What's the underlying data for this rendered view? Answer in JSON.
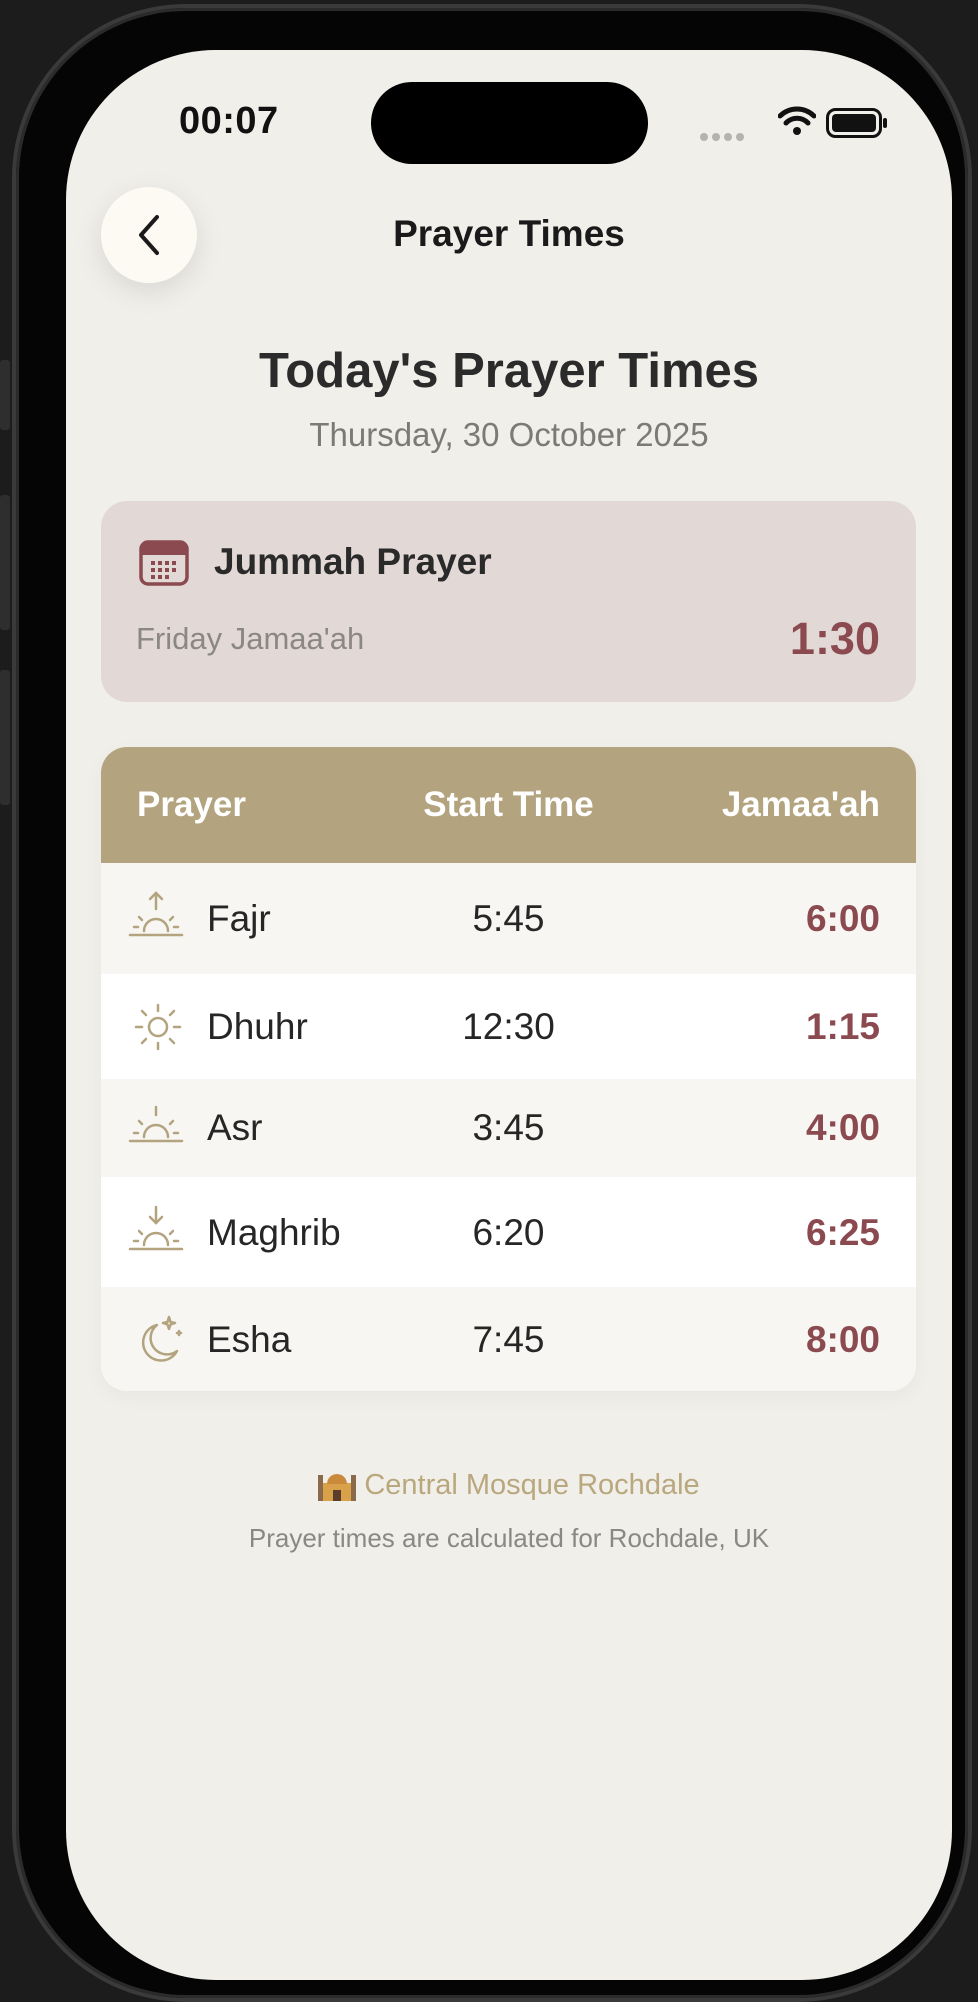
{
  "status_bar": {
    "time": "00:07"
  },
  "nav": {
    "title": "Prayer Times",
    "back_icon": "chevron-left-icon"
  },
  "header": {
    "title": "Today's Prayer Times",
    "date": "Thursday, 30 October 2025"
  },
  "jummah": {
    "icon": "calendar-icon",
    "title": "Jummah Prayer",
    "subtitle": "Friday Jamaa'ah",
    "time": "1:30"
  },
  "table": {
    "headers": {
      "prayer": "Prayer",
      "start": "Start Time",
      "jamaah": "Jamaa'ah"
    },
    "rows": [
      {
        "icon": "sunrise-icon",
        "name": "Fajr",
        "start": "5:45",
        "jamaah": "6:00"
      },
      {
        "icon": "sun-icon",
        "name": "Dhuhr",
        "start": "12:30",
        "jamaah": "1:15"
      },
      {
        "icon": "horizon-sun-icon",
        "name": "Asr",
        "start": "3:45",
        "jamaah": "4:00"
      },
      {
        "icon": "sunset-icon",
        "name": "Maghrib",
        "start": "6:20",
        "jamaah": "6:25"
      },
      {
        "icon": "moon-stars-icon",
        "name": "Esha",
        "start": "7:45",
        "jamaah": "8:00"
      }
    ]
  },
  "footer": {
    "mosque_icon": "mosque-icon",
    "mosque_name": "Central Mosque Rochdale",
    "note": "Prayer times are calculated for Rochdale, UK"
  },
  "colors": {
    "background": "#f1efea",
    "accent_gold": "#b3a47f",
    "accent_maroon": "#8b4a4f",
    "jummah_card": "#e2d8d6"
  }
}
